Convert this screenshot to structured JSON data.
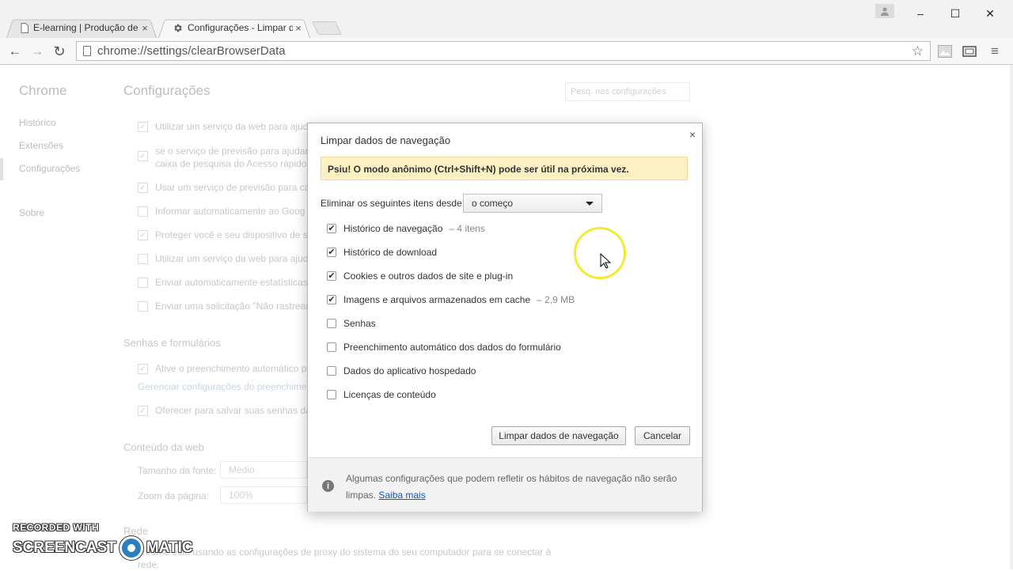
{
  "tabs": [
    {
      "title": "E-learning | Produção de",
      "close": "×",
      "active": false
    },
    {
      "title": "Configurações - Limpar d",
      "close": "×",
      "active": true
    }
  ],
  "window_controls": {
    "minimize": "–",
    "maximize": "☐",
    "close": "✕"
  },
  "toolbar": {
    "url": "chrome://settings/clearBrowserData",
    "back": "←",
    "forward": "→",
    "reload": "↻",
    "star": "☆",
    "menu": "≡"
  },
  "settings": {
    "sidebar_title": "Chrome",
    "sidebar_items": [
      "Histórico",
      "Extensões",
      "Configurações",
      "Sobre"
    ],
    "page_title": "Configurações",
    "search_placeholder": "Pesq. nas configurações",
    "privacy_rows": [
      {
        "checked": true,
        "text": "Utilizar um serviço da web para ajud"
      },
      {
        "checked": true,
        "text": "se o serviço de previsão para ajudar",
        "text2": "caixa de pesquisa do Acesso rápido"
      },
      {
        "checked": true,
        "text": "Usar um serviço de previsão para ca"
      },
      {
        "checked": false,
        "text": "Informar automaticamente ao Goog"
      },
      {
        "checked": true,
        "text": "Proteger você e seu dispositivo de s"
      },
      {
        "checked": false,
        "text": "Utilizar um serviço da web para ajud"
      },
      {
        "checked": false,
        "text": "Enviar automaticamente estatísticas"
      },
      {
        "checked": false,
        "text": "Enviar uma solicitação \"Não rastrear"
      }
    ],
    "passwords_heading": "Senhas e formulários",
    "autofill_row": "Ative o preenchimento automático p",
    "manage_autofill_link": "Gerenciar configurações do preenchimer",
    "save_passwords_row": "Oferecer para salvar suas senhas da",
    "web_content_heading": "Conteúdo da web",
    "font_size_label": "Tamanho da fonte:",
    "font_size_value": "Médio",
    "zoom_label": "Zoom da página:",
    "zoom_value": "100%",
    "network_heading": "Rede",
    "network_text": "chrome está usando as configurações de proxy do sistema do seu computador para se conectar à",
    "network_text2": "rede."
  },
  "dialog": {
    "title": "Limpar dados de navegação",
    "close": "×",
    "incognito_tip": "Psiu! O modo anônimo (Ctrl+Shift+N) pode ser útil na próxima vez.",
    "range_label": "Eliminar os seguintes itens desde:",
    "range_value": "o começo",
    "options": [
      {
        "label": "Histórico de navegação",
        "detail": "– 4 itens",
        "checked": true
      },
      {
        "label": "Histórico de download",
        "detail": "",
        "checked": true
      },
      {
        "label": "Cookies e outros dados de site e plug-in",
        "detail": "",
        "checked": true
      },
      {
        "label": "Imagens e arquivos armazenados em cache",
        "detail": "– 2,9 MB",
        "checked": true
      },
      {
        "label": "Senhas",
        "detail": "",
        "checked": false
      },
      {
        "label": "Preenchimento automático dos dados do formulário",
        "detail": "",
        "checked": false
      },
      {
        "label": "Dados do aplicativo hospedado",
        "detail": "",
        "checked": false
      },
      {
        "label": "Licenças de conteúdo",
        "detail": "",
        "checked": false
      }
    ],
    "clear_button": "Limpar dados de navegação",
    "cancel_button": "Cancelar",
    "footer_text": "Algumas configurações que podem refletir os hábitos de navegação não serão limpas.",
    "learn_more": "Saiba mais",
    "info_icon": "i"
  },
  "watermark": {
    "line1": "RECORDED WITH",
    "left": "SCREENCAST",
    "right": "MATIC"
  }
}
